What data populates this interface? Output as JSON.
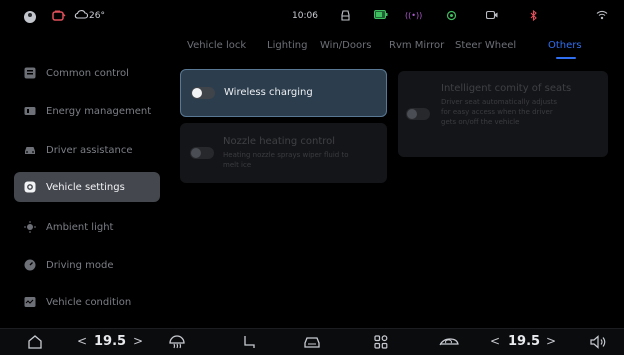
{
  "status_bar": {
    "weather": "26°",
    "time": "10:06"
  },
  "tabs": [
    "Vehicle lock",
    "Lighting",
    "Win/Doors",
    "Rvm Mirror",
    "Steer Wheel",
    "Others"
  ],
  "active_tab_index": 5,
  "sidebar": {
    "items": [
      {
        "label": "Common control",
        "icon": "grid-icon"
      },
      {
        "label": "Energy management",
        "icon": "battery-icon"
      },
      {
        "label": "Driver assistance",
        "icon": "car-front-icon"
      },
      {
        "label": "Vehicle settings",
        "icon": "gear-icon"
      },
      {
        "label": "Ambient light",
        "icon": "sun-icon"
      },
      {
        "label": "Driving mode",
        "icon": "dial-icon"
      },
      {
        "label": "Vehicle condition",
        "icon": "monitor-icon"
      }
    ],
    "active_index": 3
  },
  "settings": {
    "wireless_charging": {
      "label": "Wireless charging",
      "enabled": false
    },
    "nozzle_heating": {
      "label": "Nozzle heating control",
      "description": "Heating nozzle sprays wiper fluid to melt ice",
      "enabled": false,
      "available": false
    },
    "intelligent_seats": {
      "label": "Intelligent comity of seats",
      "description": "Driver seat automatically adjusts for easy access when the driver gets on/off the vehicle",
      "enabled": false,
      "available": false
    }
  },
  "bottom_bar": {
    "left_temp": "19.5",
    "right_temp": "19.5",
    "prev_symbol": "<",
    "next_symbol": ">"
  },
  "colors": {
    "accent": "#2f6ff0",
    "active_card_bg": "#2c3d4d",
    "active_card_border": "#587894",
    "fuel_icon": "#e0505a",
    "battery_icon": "#3fbf5f"
  }
}
